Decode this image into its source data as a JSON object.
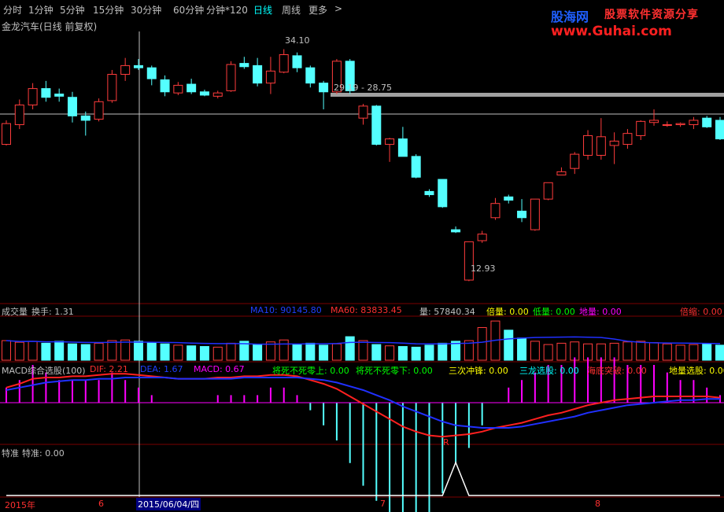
{
  "tabs": [
    {
      "label": "分时",
      "active": false
    },
    {
      "label": "1分钟",
      "active": false
    },
    {
      "label": "5分钟",
      "active": false
    },
    {
      "label": "15分钟",
      "active": false
    },
    {
      "label": "30分钟",
      "active": false
    },
    {
      "label": "60分钟",
      "active": false
    },
    {
      "label": "分钟*120",
      "active": false
    },
    {
      "label": "日线",
      "active": true
    },
    {
      "label": "周线",
      "active": false
    },
    {
      "label": "更多",
      "active": false
    }
  ],
  "more_arrow": ">",
  "logo": {
    "main": "股海网",
    "sub": "股票软件资源分享",
    "url": "www.Guhai.com"
  },
  "stock_title": "金龙汽车(日线 前复权)",
  "price_annotations": {
    "high": "34.10",
    "low": "12.93",
    "range": "29.19 - 28.75"
  },
  "volume_panel": {
    "title": "成交量",
    "turnover_label": "换手: 1.31",
    "ma10": "MA10: 90145.80",
    "ma60": "MA60: 83833.45",
    "vol": "量: 57840.34",
    "bei": "倍量: 0.00",
    "di": "低量: 0.00",
    "diliang": "地量: 0.00",
    "beisuo": "倍缩: 0.00"
  },
  "macd_panel": {
    "title": "MACD综合选股(100)",
    "dif": "DIF: 2.21",
    "dea": "DEA: 1.67",
    "macd": "MACD: 0.67",
    "s1": "将死不死零上: 0.00",
    "s2": "将死不死零下: 0.00",
    "s3": "三次冲锋: 0.00",
    "s4": "三龙选股: 0.00",
    "s5": "海底突破: 0.00",
    "s6": "地量选股: 0.00",
    "marker": "R"
  },
  "special_panel": {
    "title": "特准",
    "value": "特准: 0.00"
  },
  "date_axis": {
    "year": "2015年",
    "m6": "6",
    "cursor_date": "2015/06/04/四",
    "m7": "7",
    "m8": "8"
  },
  "colors": {
    "up": "#ff3c3c",
    "down": "#54ffff",
    "bg": "#000000",
    "grid": "#7a0000",
    "dif": "#ff2020",
    "dea": "#2030ff",
    "macd_pos": "#ff00ff",
    "macd_neg": "#54ffff"
  },
  "chart_data": {
    "type": "candlestick",
    "note": "daily OHLC bars, left to right",
    "ohlc": [
      [
        25.4,
        27.6,
        25.3,
        27.3
      ],
      [
        27.2,
        29.5,
        26.8,
        29.0
      ],
      [
        29.0,
        31.0,
        28.6,
        30.5
      ],
      [
        30.5,
        31.2,
        29.3,
        29.7
      ],
      [
        30.0,
        30.5,
        29.3,
        29.8
      ],
      [
        29.7,
        30.2,
        27.4,
        28.0
      ],
      [
        28.0,
        28.4,
        26.2,
        27.6
      ],
      [
        27.7,
        29.6,
        27.5,
        29.3
      ],
      [
        29.4,
        32.2,
        29.2,
        31.8
      ],
      [
        31.8,
        33.3,
        31.2,
        32.6
      ],
      [
        32.6,
        33.2,
        32.2,
        32.4
      ],
      [
        32.4,
        32.6,
        30.8,
        31.4
      ],
      [
        31.3,
        31.7,
        29.8,
        30.2
      ],
      [
        30.1,
        31.1,
        29.9,
        30.8
      ],
      [
        30.9,
        31.4,
        30.0,
        30.2
      ],
      [
        30.2,
        30.4,
        29.8,
        29.9
      ],
      [
        29.8,
        30.3,
        29.6,
        30.1
      ],
      [
        30.3,
        33.0,
        30.2,
        32.7
      ],
      [
        32.8,
        33.4,
        32.3,
        32.5
      ],
      [
        32.6,
        33.3,
        30.7,
        31.0
      ],
      [
        31.0,
        33.4,
        30.0,
        32.1
      ],
      [
        32.0,
        34.1,
        31.9,
        33.6
      ],
      [
        33.5,
        33.8,
        32.0,
        32.4
      ],
      [
        32.4,
        32.6,
        30.6,
        31.0
      ],
      [
        31.0,
        31.2,
        28.6,
        30.2
      ],
      [
        30.2,
        33.2,
        30.0,
        33.0
      ],
      [
        33.0,
        33.2,
        30.0,
        30.3
      ],
      [
        27.8,
        29.1,
        27.2,
        28.9
      ],
      [
        28.9,
        29.0,
        25.3,
        25.4
      ],
      [
        25.4,
        26.0,
        23.8,
        25.9
      ],
      [
        25.9,
        27.0,
        25.0,
        24.3
      ],
      [
        24.3,
        24.5,
        22.3,
        22.4
      ],
      [
        21.1,
        21.3,
        20.6,
        20.8
      ],
      [
        22.2,
        22.2,
        19.6,
        19.7
      ],
      [
        17.6,
        17.9,
        17.3,
        17.4
      ],
      [
        13.0,
        16.5,
        12.9,
        16.5
      ],
      [
        16.6,
        17.5,
        16.4,
        17.2
      ],
      [
        18.7,
        20.5,
        18.5,
        20.0
      ],
      [
        20.6,
        20.8,
        20.0,
        20.3
      ],
      [
        19.3,
        20.4,
        18.3,
        18.7
      ],
      [
        17.6,
        20.4,
        17.5,
        20.4
      ],
      [
        20.4,
        21.9,
        20.3,
        21.9
      ],
      [
        22.6,
        23.3,
        22.6,
        22.9
      ],
      [
        23.2,
        24.7,
        22.7,
        24.5
      ],
      [
        24.4,
        26.7,
        24.0,
        26.2
      ],
      [
        24.4,
        27.8,
        24.0,
        26.1
      ],
      [
        25.3,
        26.5,
        23.6,
        25.7
      ],
      [
        25.4,
        26.8,
        25.0,
        26.4
      ],
      [
        26.2,
        27.6,
        25.8,
        27.5
      ],
      [
        27.4,
        28.6,
        27.1,
        27.6
      ],
      [
        27.2,
        27.5,
        27.0,
        27.2
      ],
      [
        27.2,
        27.4,
        27.0,
        27.3
      ],
      [
        27.2,
        27.9,
        26.8,
        27.6
      ],
      [
        27.8,
        28.0,
        26.9,
        27.0
      ],
      [
        27.6,
        27.9,
        25.8,
        25.9
      ]
    ],
    "volume": [
      60,
      55,
      58,
      52,
      58,
      50,
      48,
      52,
      60,
      62,
      58,
      54,
      50,
      46,
      44,
      42,
      40,
      52,
      58,
      48,
      56,
      62,
      48,
      52,
      46,
      50,
      72,
      60,
      48,
      44,
      42,
      40,
      46,
      52,
      58,
      60,
      100,
      120,
      92,
      68,
      58,
      48,
      52,
      56,
      50,
      50,
      52,
      56,
      58,
      54,
      50,
      46,
      48,
      50,
      46
    ],
    "dif": [
      1.2,
      1.5,
      1.9,
      2.0,
      2.0,
      2.1,
      2.1,
      2.2,
      2.3,
      2.3,
      2.2,
      2.1,
      2.0,
      1.9,
      1.9,
      1.9,
      2.0,
      2.0,
      2.1,
      2.1,
      2.2,
      2.2,
      2.1,
      1.8,
      1.5,
      1.1,
      0.5,
      -0.1,
      -0.7,
      -1.3,
      -1.9,
      -2.3,
      -2.6,
      -2.7,
      -2.6,
      -2.5,
      -2.3,
      -2.0,
      -1.8,
      -1.6,
      -1.3,
      -1.0,
      -0.8,
      -0.5,
      -0.2,
      0.0,
      0.2,
      0.3,
      0.4,
      0.5,
      0.5,
      0.5,
      0.5,
      0.5,
      0.4
    ],
    "dea": [
      1.0,
      1.2,
      1.4,
      1.6,
      1.7,
      1.8,
      1.8,
      1.9,
      1.9,
      2.0,
      2.0,
      2.0,
      2.0,
      1.9,
      1.9,
      1.9,
      1.9,
      1.9,
      2.0,
      2.0,
      2.0,
      2.0,
      2.0,
      1.9,
      1.8,
      1.6,
      1.3,
      1.0,
      0.6,
      0.2,
      -0.3,
      -0.7,
      -1.1,
      -1.5,
      -1.8,
      -1.9,
      -2.0,
      -2.0,
      -2.0,
      -1.9,
      -1.7,
      -1.5,
      -1.3,
      -1.1,
      -0.8,
      -0.6,
      -0.4,
      -0.2,
      -0.1,
      0.0,
      0.1,
      0.2,
      0.2,
      0.3,
      0.3
    ],
    "special": [
      0,
      0,
      0,
      0,
      0,
      0,
      0,
      0,
      0,
      0,
      0,
      0,
      0,
      0,
      0,
      0,
      0,
      0,
      0,
      0,
      0,
      0,
      0,
      0,
      0,
      0,
      0,
      0,
      0,
      0,
      0,
      0,
      0,
      0,
      1,
      0,
      0,
      0,
      0,
      0,
      0,
      0,
      0,
      0,
      0,
      0,
      0,
      0,
      0,
      0,
      0,
      0,
      0,
      0,
      0
    ]
  }
}
